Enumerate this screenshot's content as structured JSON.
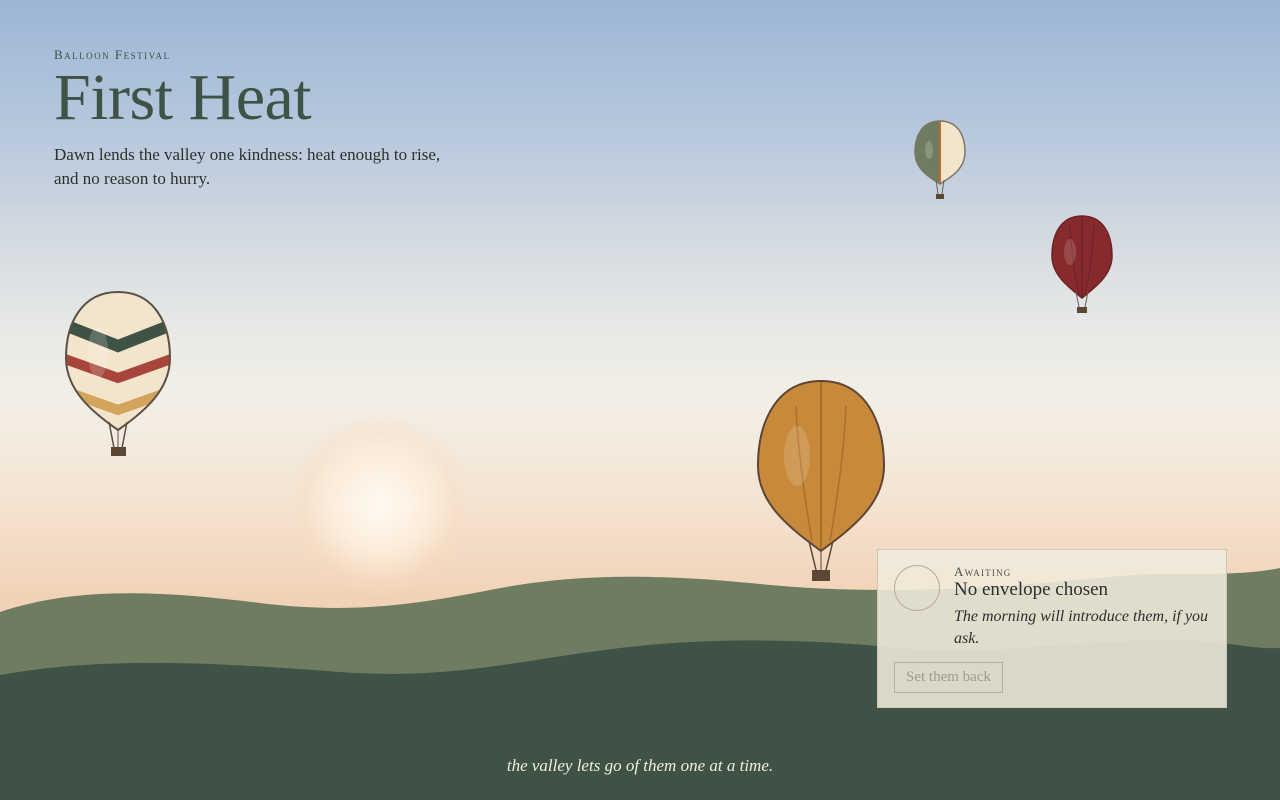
{
  "header": {
    "kicker": "Balloon Festival",
    "title": "First Heat",
    "tagline": "Dawn lends the valley one kindness: heat enough to rise, and no reason to hurry."
  },
  "balloons": [
    {
      "name": "chevron",
      "colors": [
        "#f3e4cc",
        "#3f5246",
        "#a8453a",
        "#d2a45c"
      ]
    },
    {
      "name": "amber",
      "colors": [
        "#c8893a",
        "#a8702a"
      ]
    },
    {
      "name": "split",
      "colors": [
        "#6e7d61",
        "#f3e4cc",
        "#c0672e"
      ]
    },
    {
      "name": "crimson",
      "colors": [
        "#862a2d",
        "#6e2224"
      ]
    }
  ],
  "panel": {
    "kicker": "Awaiting",
    "title": "No envelope chosen",
    "description": "The morning will introduce them, if you ask.",
    "button_label": "Set them back"
  },
  "footer": {
    "text": "the valley lets go of them one at a time."
  },
  "colors": {
    "sky_top": "#9db6d6",
    "horizon": "#f2d2b6",
    "far_hill": "#6e7d61",
    "near_hill": "#3f5246"
  }
}
